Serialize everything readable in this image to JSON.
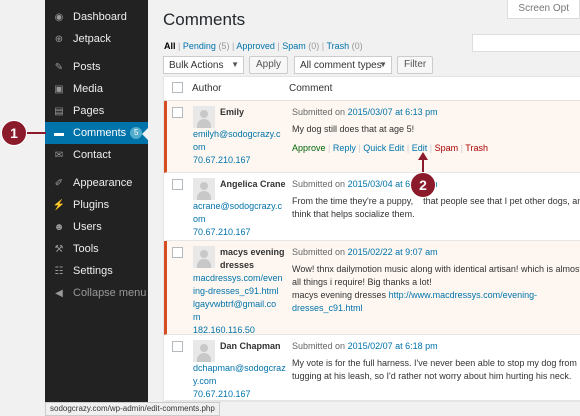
{
  "sidebar": {
    "items": [
      {
        "label": "Dashboard",
        "icon": "dashboard-icon",
        "glyph": "◉"
      },
      {
        "label": "Jetpack",
        "icon": "jetpack-icon",
        "glyph": "⊕"
      },
      {
        "label": "Posts",
        "icon": "pushpin-icon",
        "glyph": "✎"
      },
      {
        "label": "Media",
        "icon": "media-icon",
        "glyph": "▣"
      },
      {
        "label": "Pages",
        "icon": "pages-icon",
        "glyph": "▤"
      },
      {
        "label": "Comments",
        "icon": "comment-bubble-icon",
        "glyph": "▬",
        "badge": "5"
      },
      {
        "label": "Contact",
        "icon": "envelope-icon",
        "glyph": "✉"
      },
      {
        "label": "Appearance",
        "icon": "paintbrush-icon",
        "glyph": "✐"
      },
      {
        "label": "Plugins",
        "icon": "plug-icon",
        "glyph": "⚡"
      },
      {
        "label": "Users",
        "icon": "users-icon",
        "glyph": "☻"
      },
      {
        "label": "Tools",
        "icon": "wrench-icon",
        "glyph": "⚒"
      },
      {
        "label": "Settings",
        "icon": "settings-icon",
        "glyph": "☷"
      },
      {
        "label": "Collapse menu",
        "icon": "collapse-icon",
        "glyph": "◀"
      }
    ]
  },
  "header": {
    "title": "Comments",
    "screen_options": "Screen Opt"
  },
  "filters": {
    "all": "All",
    "pending": "Pending",
    "pending_count": "(5)",
    "approved": "Approved",
    "spam": "Spam",
    "spam_count": "(0)",
    "trash": "Trash",
    "trash_count": "(0)",
    "sep": "|"
  },
  "toolbar": {
    "bulk_actions": "Bulk Actions",
    "apply": "Apply",
    "comment_types": "All comment types",
    "filter": "Filter"
  },
  "table": {
    "col_author": "Author",
    "col_comment": "Comment",
    "rows": [
      {
        "name": "Emily",
        "email_1": "emilyh@sodogcrazy.c",
        "email_2": "om",
        "ip": "70.67.210.167",
        "submitted_prefix": "Submitted on",
        "date": "2015/03/07 at 6:13 pm",
        "text": "My dog still does that at age 5!",
        "pending": true
      },
      {
        "name": "Angelica Crane",
        "email_1": "acrane@sodogcrazy.c",
        "email_2": "om",
        "ip": "70.67.210.167",
        "submitted_prefix": "Submitted on",
        "date": "2015/03/04 at 6:13 pm",
        "text_1": "From the time they're a puppy,",
        "text_1b": "that people see that I pet other dogs, and I",
        "text_2": "think that helps socialize them.",
        "pending": false
      },
      {
        "name_1": "macys evening",
        "name_2": "dresses",
        "url_1": "macdressys.com/even",
        "url_2": "ing-dresses_c91.html",
        "email_1": "lgayvwbtrf@gmail.co",
        "email_2": "m",
        "ip": "182.160.116.50",
        "submitted_prefix": "Submitted on",
        "date": "2015/02/22 at 9:07 am",
        "text_1": "Wow! thnx dailymotion music along with identical artisan! which is almost",
        "text_2": "all things i require! Big thanks a lot!",
        "text_3": "macys evening dresses",
        "link_1": "http://www.macdressys.com/evening-",
        "link_2": "dresses_c91.html",
        "pending": true
      },
      {
        "name": "Dan Chapman",
        "email_1": "dchapman@sodogcraz",
        "email_2": "y.com",
        "ip": "70.67.210.167",
        "submitted_prefix": "Submitted on",
        "date": "2015/02/07 at 6:18 pm",
        "text_1": "My vote is for the full harness. I've never been able to stop my dog from",
        "text_2": "tugging at his leash, so I'd rather not worry about him hurting his neck.",
        "pending": false
      }
    ]
  },
  "row_actions": {
    "approve": "Approve",
    "reply": "Reply",
    "quick_edit": "Quick Edit",
    "edit": "Edit",
    "spam": "Spam",
    "trash": "Trash"
  },
  "statusbar": "sodogcrazy.com/wp-admin/edit-comments.php",
  "callouts": {
    "one": "1",
    "two": "2"
  },
  "colors": {
    "sidebar": "#222222",
    "active": "#0073aa",
    "link": "#0073aa",
    "callout": "#8b1a2b",
    "pending_border": "#d54e21"
  }
}
